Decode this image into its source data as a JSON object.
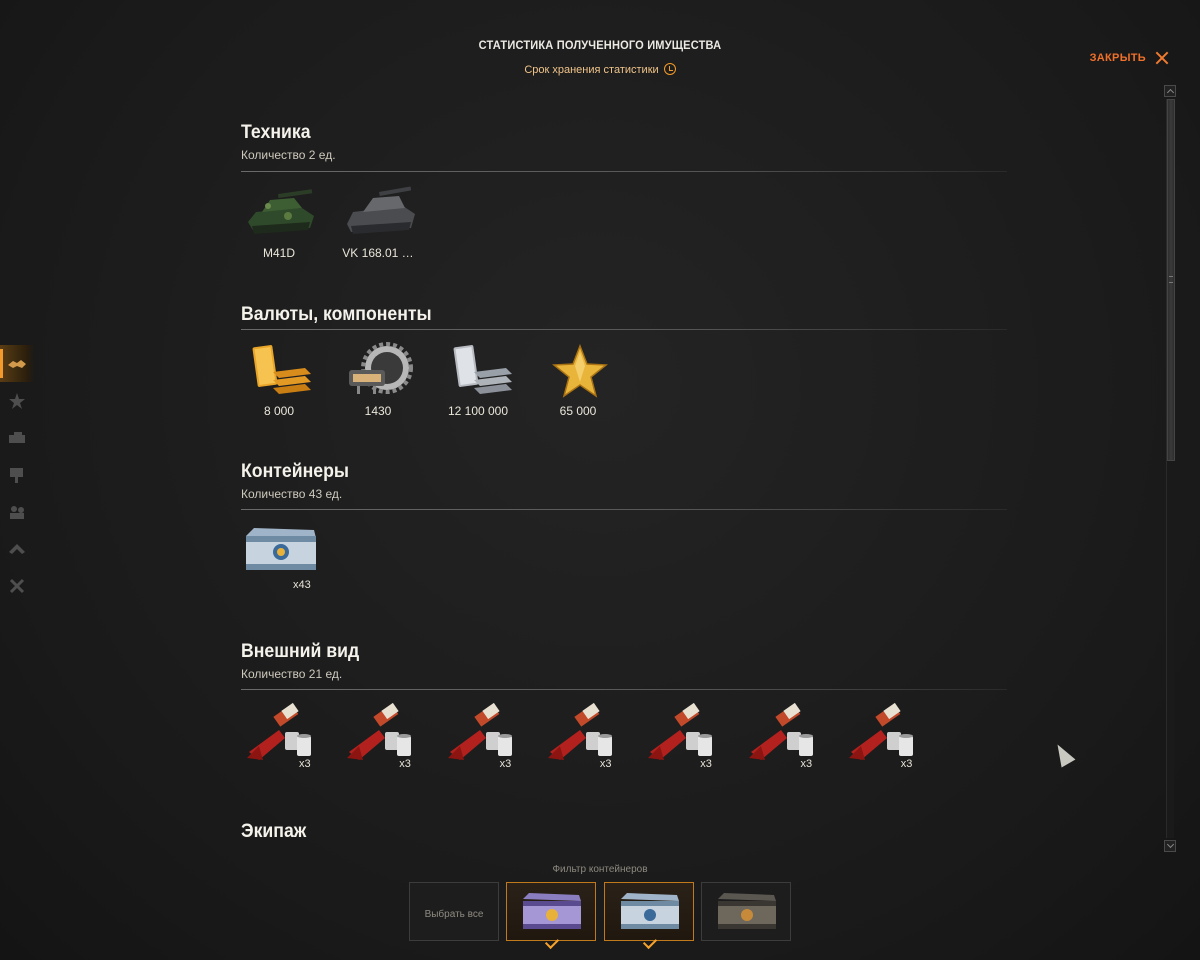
{
  "header": {
    "title": "СТАТИСТИКА ПОЛУЧЕННОГО ИМУЩЕСТВА",
    "subtitle": "Срок хранения статистики",
    "close_label": "ЗАКРЫТЬ"
  },
  "sections": {
    "vehicles": {
      "title": "Техника",
      "count": "Количество 2 ед.",
      "items": [
        {
          "label": "M41D",
          "icon": "tank-green-icon"
        },
        {
          "label": "VK 168.01 …",
          "icon": "tank-grey-icon"
        }
      ]
    },
    "currencies": {
      "title": "Валюты, компоненты",
      "items": [
        {
          "label": "8 000",
          "icon": "gold-bars-icon"
        },
        {
          "label": "1430",
          "icon": "equipment-gear-icon"
        },
        {
          "label": "12 100 000",
          "icon": "silver-bars-icon"
        },
        {
          "label": "65 000",
          "icon": "free-xp-star-icon"
        }
      ]
    },
    "containers": {
      "title": "Контейнеры",
      "count": "Количество 43 ед.",
      "items": [
        {
          "qty": "x43",
          "icon": "container-silver-icon"
        }
      ]
    },
    "appearance": {
      "title": "Внешний вид",
      "count": "Количество 21 ед.",
      "items": [
        {
          "qty": "x3",
          "icon": "camouflage-paint-icon"
        },
        {
          "qty": "x3",
          "icon": "camouflage-paint-icon"
        },
        {
          "qty": "x3",
          "icon": "camouflage-paint-icon"
        },
        {
          "qty": "x3",
          "icon": "camouflage-paint-icon"
        },
        {
          "qty": "x3",
          "icon": "camouflage-paint-icon"
        },
        {
          "qty": "x3",
          "icon": "camouflage-paint-icon"
        },
        {
          "qty": "x3",
          "icon": "camouflage-paint-icon"
        }
      ]
    },
    "crew": {
      "title": "Экипаж"
    }
  },
  "filter": {
    "label": "Фильтр контейнеров",
    "select_all": "Выбрать все",
    "options": [
      {
        "icon": "container-purple-icon",
        "selected": true
      },
      {
        "icon": "container-silver-icon",
        "selected": true
      },
      {
        "icon": "container-dark-icon",
        "selected": false
      }
    ]
  },
  "colors": {
    "accent": "#f29a2c",
    "close": "#f0702a",
    "background": "#1c1c1c"
  }
}
